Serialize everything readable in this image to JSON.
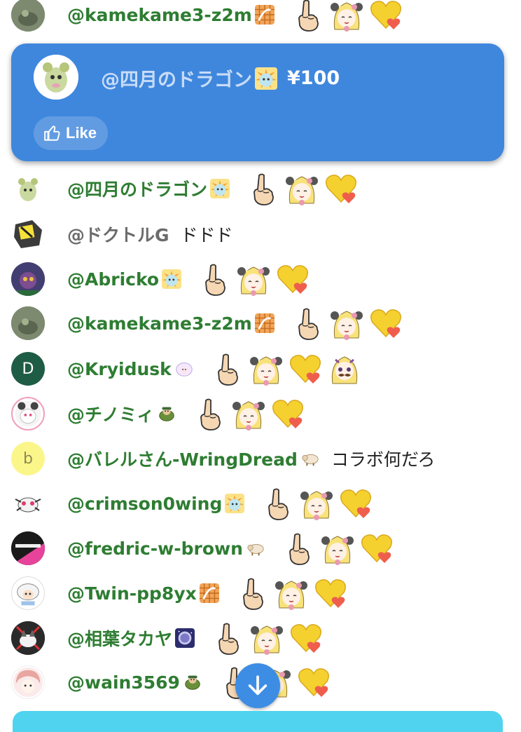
{
  "superchat": {
    "author": "@四月のドラゴン",
    "amount": "¥100",
    "like_label": "Like"
  },
  "messages": [
    {
      "author": "@kamekame3-z2m",
      "badge": "orange-grid-badge",
      "emojis": [
        "finger-up",
        "girl-face",
        "yellow-heart"
      ],
      "text": ""
    },
    {
      "author": "@四月のドラゴン",
      "badge": "yellow-burst-badge",
      "emojis": [
        "finger-up",
        "girl-face",
        "yellow-heart"
      ],
      "text": ""
    },
    {
      "author": "@ドクトルG",
      "badge": "",
      "emojis": [],
      "text": "ドドド"
    },
    {
      "author": "@Abricko",
      "badge": "yellow-burst-badge",
      "emojis": [
        "finger-up",
        "girl-face",
        "yellow-heart"
      ],
      "text": ""
    },
    {
      "author": "@kamekame3-z2m",
      "badge": "orange-grid-badge",
      "emojis": [
        "finger-up",
        "girl-face",
        "yellow-heart"
      ],
      "text": ""
    },
    {
      "author": "@Kryidusk",
      "badge": "sheep-badge",
      "emojis": [
        "finger-up",
        "girl-face",
        "yellow-heart",
        "mustache-face"
      ],
      "text": ""
    },
    {
      "author": "@チノミィ",
      "badge": "turtle-badge",
      "emojis": [
        "finger-up",
        "girl-face",
        "yellow-heart"
      ],
      "text": ""
    },
    {
      "author": "@バレルさん-WringDread",
      "badge": "sheep-small-badge",
      "emojis": [],
      "text": "コラボ何だろ"
    },
    {
      "author": "@crimson0wing",
      "badge": "yellow-burst-badge",
      "emojis": [
        "finger-up",
        "girl-face",
        "yellow-heart"
      ],
      "text": ""
    },
    {
      "author": "@fredric-w-brown",
      "badge": "sheep-small-badge",
      "emojis": [
        "finger-up",
        "girl-face",
        "yellow-heart"
      ],
      "text": ""
    },
    {
      "author": "@Twin-pp8yx",
      "badge": "orange-grid-badge",
      "emojis": [
        "finger-up",
        "girl-face",
        "yellow-heart"
      ],
      "text": ""
    },
    {
      "author": "@相葉タカヤ",
      "badge": "astronaut-badge",
      "emojis": [
        "finger-up",
        "girl-face",
        "yellow-heart"
      ],
      "text": ""
    },
    {
      "author": "@wain3569",
      "badge": "turtle-badge",
      "emojis": [
        "finger-up",
        "girl-face",
        "yellow-heart"
      ],
      "text": ""
    }
  ],
  "avatars": {
    "kryidusk_letter": "D",
    "barrel_letter": "b"
  },
  "colors": {
    "author_member": "#2e7d32",
    "author_plain": "#6b6b6b",
    "superchat_bg": "#3f87dd",
    "fab_bg": "#3d8de4"
  }
}
